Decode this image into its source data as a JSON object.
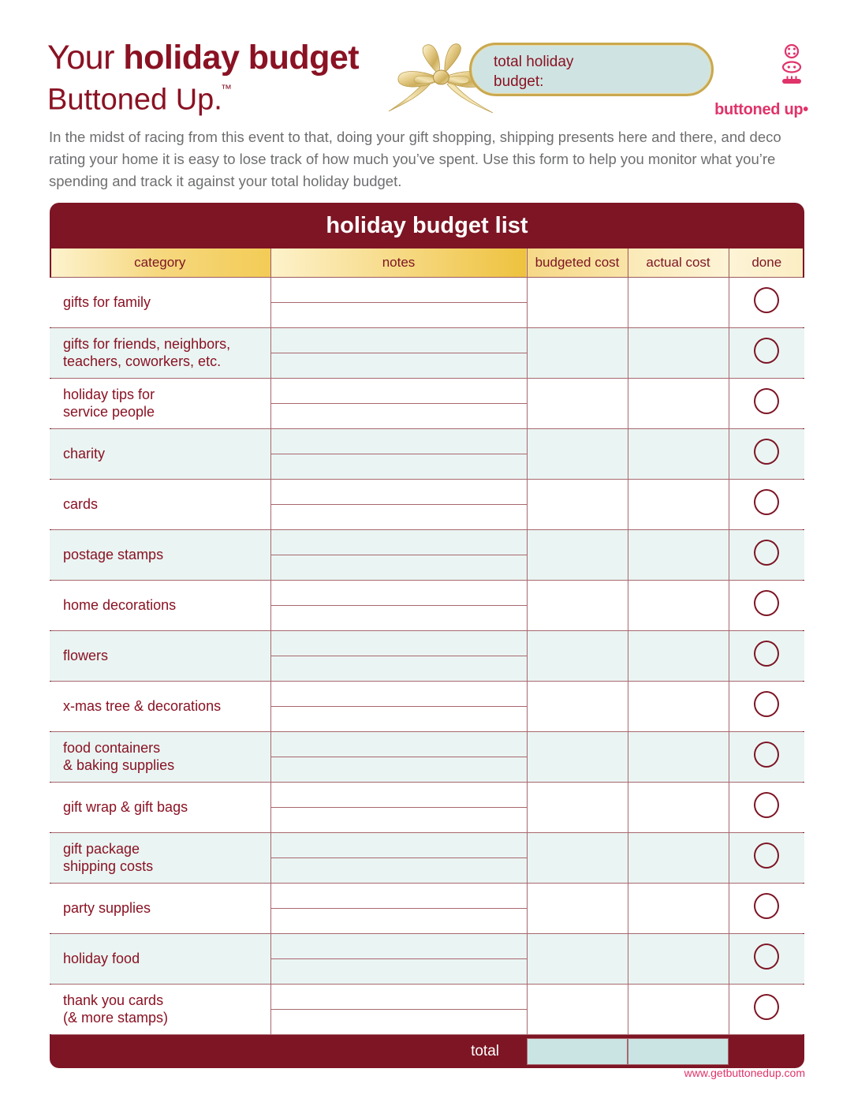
{
  "header": {
    "title_word1": "Your ",
    "title_word2": "holiday budget",
    "brand_line": "Buttoned Up",
    "trademark": "™",
    "budget_pill_label": "total holiday\nbudget:",
    "logo_text": "buttoned up•"
  },
  "intro": {
    "paragraph": "In the midst of racing from this event to that, doing your gift shopping, shipping presents here and there, and deco rating your home it is easy to lose track of how much you’ve spent. Use this form to help you monitor what you’re spending and track it against your total holiday budget."
  },
  "table": {
    "title": "holiday budget list",
    "columns": {
      "category": "category",
      "notes": "notes",
      "budgeted_cost": "budgeted cost",
      "actual_cost": "actual cost",
      "done": "done"
    },
    "rows": [
      {
        "category": "gifts for family",
        "notes": "",
        "budgeted_cost": "",
        "actual_cost": "",
        "done": false
      },
      {
        "category": "gifts for friends, neighbors,\nteachers, coworkers, etc.",
        "notes": "",
        "budgeted_cost": "",
        "actual_cost": "",
        "done": false
      },
      {
        "category": "holiday tips for\nservice people",
        "notes": "",
        "budgeted_cost": "",
        "actual_cost": "",
        "done": false
      },
      {
        "category": "charity",
        "notes": "",
        "budgeted_cost": "",
        "actual_cost": "",
        "done": false
      },
      {
        "category": "cards",
        "notes": "",
        "budgeted_cost": "",
        "actual_cost": "",
        "done": false
      },
      {
        "category": "postage stamps",
        "notes": "",
        "budgeted_cost": "",
        "actual_cost": "",
        "done": false
      },
      {
        "category": "home decorations",
        "notes": "",
        "budgeted_cost": "",
        "actual_cost": "",
        "done": false
      },
      {
        "category": "flowers",
        "notes": "",
        "budgeted_cost": "",
        "actual_cost": "",
        "done": false
      },
      {
        "category": "x-mas tree & decorations",
        "notes": "",
        "budgeted_cost": "",
        "actual_cost": "",
        "done": false
      },
      {
        "category": "food containers\n& baking supplies",
        "notes": "",
        "budgeted_cost": "",
        "actual_cost": "",
        "done": false
      },
      {
        "category": "gift wrap & gift bags",
        "notes": "",
        "budgeted_cost": "",
        "actual_cost": "",
        "done": false
      },
      {
        "category": "gift package\nshipping costs",
        "notes": "",
        "budgeted_cost": "",
        "actual_cost": "",
        "done": false
      },
      {
        "category": "party supplies",
        "notes": "",
        "budgeted_cost": "",
        "actual_cost": "",
        "done": false
      },
      {
        "category": "holiday food",
        "notes": "",
        "budgeted_cost": "",
        "actual_cost": "",
        "done": false
      },
      {
        "category": "thank you cards\n(& more stamps)",
        "notes": "",
        "budgeted_cost": "",
        "actual_cost": "",
        "done": false
      }
    ],
    "total_label": "total",
    "total_budgeted": "",
    "total_actual": ""
  },
  "footer": {
    "url": "www.getbuttonedup.com"
  },
  "colors": {
    "dark_red": "#7d1524",
    "title_red": "#8a1223",
    "pink": "#e0336a",
    "gold": "#e9c96a",
    "mint_row": "#eaf5f3",
    "pill_blue": "#cfe4e2",
    "total_box_blue": "#c9e4e3",
    "body_gray": "#6d6e70"
  }
}
